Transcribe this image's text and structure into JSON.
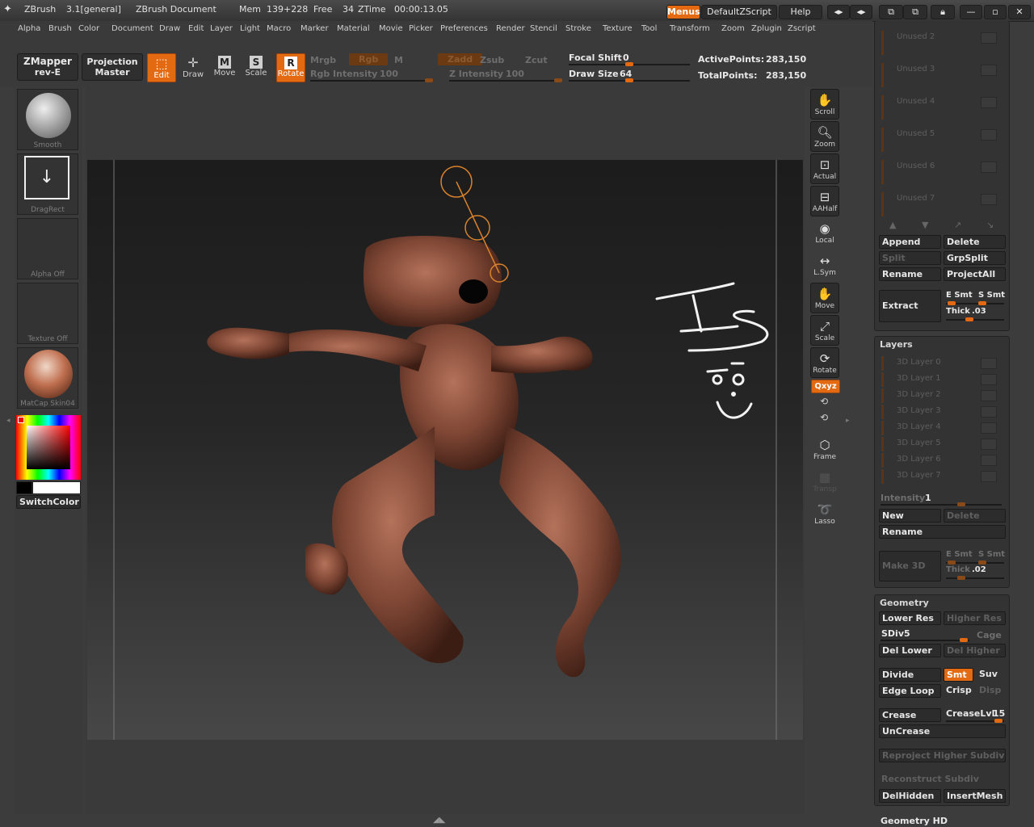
{
  "title_bar": {
    "app_name": "ZBrush",
    "version": "3.1[general]",
    "document": "ZBrush Document",
    "mem_label": "Mem",
    "mem_value": "139+228",
    "free_label": "Free",
    "free_value": "34",
    "ztime_label": "ZTime",
    "ztime_value": "00:00:13.05",
    "menus_button": "Menus",
    "zscript_button": "DefaultZScript",
    "help_button": "Help"
  },
  "menu": [
    "Alpha",
    "Brush",
    "Color",
    "Document",
    "Draw",
    "Edit",
    "Layer",
    "Light",
    "Macro",
    "Marker",
    "Material",
    "Movie",
    "Picker",
    "Preferences",
    "Render",
    "Stencil",
    "Stroke",
    "Texture",
    "Tool",
    "Transform",
    "Zoom",
    "Zplugin",
    "Zscript"
  ],
  "top_shelf": {
    "zmapper_label": "ZMapper",
    "zmapper_sub": "rev-E",
    "projection_label": "Projection",
    "projection_sub": "Master",
    "tools": [
      {
        "label": "Edit",
        "icon": "edit-icon",
        "active": true
      },
      {
        "label": "Draw",
        "icon": "draw-icon",
        "active": false
      },
      {
        "label": "Move",
        "icon": "move-icon",
        "active": false
      },
      {
        "label": "Scale",
        "icon": "scale-icon",
        "active": false
      },
      {
        "label": "Rotate",
        "icon": "rotate-icon",
        "active": true
      }
    ],
    "mrgb": "Mrgb",
    "rgb": "Rgb",
    "m": "M",
    "zadd": "Zadd",
    "zsub": "Zsub",
    "zcut": "Zcut",
    "rgb_intensity_label": "Rgb Intensity",
    "rgb_intensity_value": "100",
    "z_intensity_label": "Z Intensity",
    "z_intensity_value": "100",
    "focal_shift_label": "Focal Shift",
    "focal_shift_value": "0",
    "draw_size_label": "Draw Size",
    "draw_size_value": "64",
    "active_points_label": "ActivePoints:",
    "active_points_value": "283,150",
    "total_points_label": "TotalPoints:",
    "total_points_value": "283,150"
  },
  "left_tray": {
    "brush_caption": "Smooth",
    "stroke_caption": "DragRect",
    "alpha_caption": "Alpha  Off",
    "texture_caption": "Texture  Off",
    "material_caption": "MatCap  Skin04",
    "switch_color": "SwitchColor"
  },
  "right_shelf": [
    {
      "label": "Scroll",
      "icon": "scroll-icon"
    },
    {
      "label": "Zoom",
      "icon": "zoom-icon"
    },
    {
      "label": "Actual",
      "icon": "actual-icon"
    },
    {
      "label": "AAHalf",
      "icon": "aahalf-icon"
    },
    {
      "label": "Local",
      "icon": "local-icon"
    },
    {
      "label": "L.Sym",
      "icon": "lsym-icon"
    },
    {
      "label": "Move",
      "icon": "move-icon"
    },
    {
      "label": "Scale",
      "icon": "scale-icon"
    },
    {
      "label": "Rotate",
      "icon": "rotate-icon"
    },
    {
      "label": "Frame",
      "icon": "frame-icon"
    },
    {
      "label": "Transp",
      "icon": "transp-icon"
    },
    {
      "label": "Lasso",
      "icon": "lasso-icon"
    }
  ],
  "xyz_button": "Qxyz",
  "subtool": {
    "unused_items": [
      "Unused 2",
      "Unused 3",
      "Unused 4",
      "Unused 5",
      "Unused 6",
      "Unused 7"
    ],
    "append": "Append",
    "delete": "Delete",
    "split": "Split",
    "grpsplit": "GrpSplit",
    "rename": "Rename",
    "projectall": "ProjectAll",
    "extract": "Extract",
    "e_smt": "E Smt",
    "s_smt": "S Smt",
    "thick_label": "Thick",
    "thick_value": ".03"
  },
  "layers": {
    "header": "Layers",
    "items": [
      "3D Layer 0",
      "3D Layer 1",
      "3D Layer 2",
      "3D Layer 3",
      "3D Layer 4",
      "3D Layer 5",
      "3D Layer 6",
      "3D Layer 7"
    ],
    "intensity_label": "Intensity",
    "intensity_value": "1",
    "new": "New",
    "delete": "Delete",
    "rename": "Rename",
    "make3d": "Make 3D",
    "e_smt": "E Smt",
    "s_smt": "S Smt",
    "thick_label": "Thick",
    "thick_value": ".02"
  },
  "geometry": {
    "header": "Geometry",
    "lower_res": "Lower Res",
    "higher_res": "Higher Res",
    "sdiv_label": "SDiv",
    "sdiv_value": "5",
    "cage": "Cage",
    "del_lower": "Del Lower",
    "del_higher": "Del Higher",
    "divide": "Divide",
    "smt": "Smt",
    "suv": "Suv",
    "edge_loop": "Edge Loop",
    "crisp": "Crisp",
    "disp": "Disp",
    "crease": "Crease",
    "creaselvl_label": "CreaseLvl",
    "creaselvl_value": "15",
    "uncrease": "UnCrease",
    "reproject": "Reproject Higher Subdiv",
    "reconstruct": "Reconstruct Subdiv",
    "delhidden": "DelHidden",
    "insertmesh": "InsertMesh"
  },
  "geometry_hd_header": "Geometry HD",
  "accent_color": "#e46a12"
}
